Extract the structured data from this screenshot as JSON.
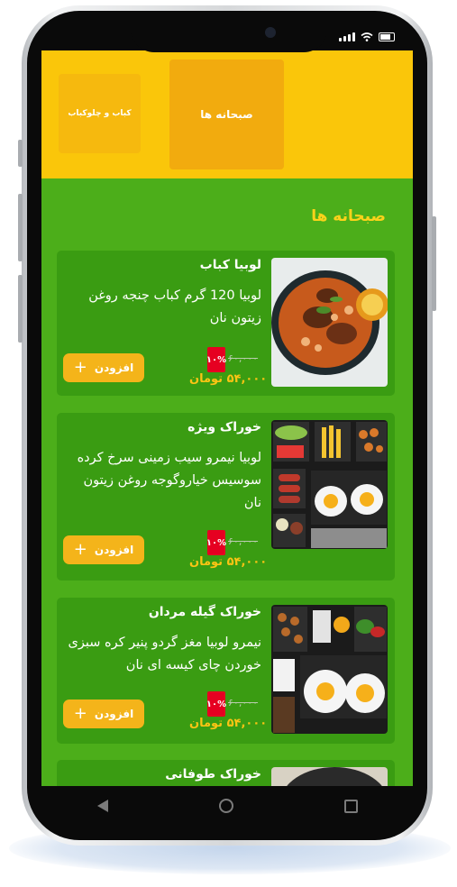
{
  "tabs": [
    {
      "label": "کباب و چلوکباب"
    },
    {
      "label": "صبحانه ها"
    }
  ],
  "section_title": "صبحانه ها",
  "items": [
    {
      "name": "لوبیا کباب",
      "description": "لوبیا 120 گرم کباب چنجه روغن زیتون نان",
      "discount": "۱۰%",
      "old_price": "۶۰,۰۰۰",
      "new_price": "۵۴,۰۰۰ تومان",
      "add_label": "افزودن"
    },
    {
      "name": "خوراک ویژه",
      "description": "لوبیا نیمرو سیب زمینی سرخ کرده سوسیس خیاروگوجه روغن زیتون نان",
      "discount": "۱۰%",
      "old_price": "۶۰,۰۰۰",
      "new_price": "۵۴,۰۰۰ تومان",
      "add_label": "افزودن"
    },
    {
      "name": "خوراک گیله مردان",
      "description": "نیمرو لوبیا مغز گردو پنیر کره سبزی خوردن چای کیسه ای نان",
      "discount": "۱۰%",
      "old_price": "۶۰,۰۰۰",
      "new_price": "۵۴,۰۰۰ تومان",
      "add_label": "افزودن"
    },
    {
      "name": "خوراک طوفانی"
    }
  ],
  "colors": {
    "header": "#fac60a",
    "background": "#4cae1a",
    "card": "#3a9c12",
    "accent": "#fcc414",
    "button": "#f4b41a",
    "discount": "#e60021"
  }
}
